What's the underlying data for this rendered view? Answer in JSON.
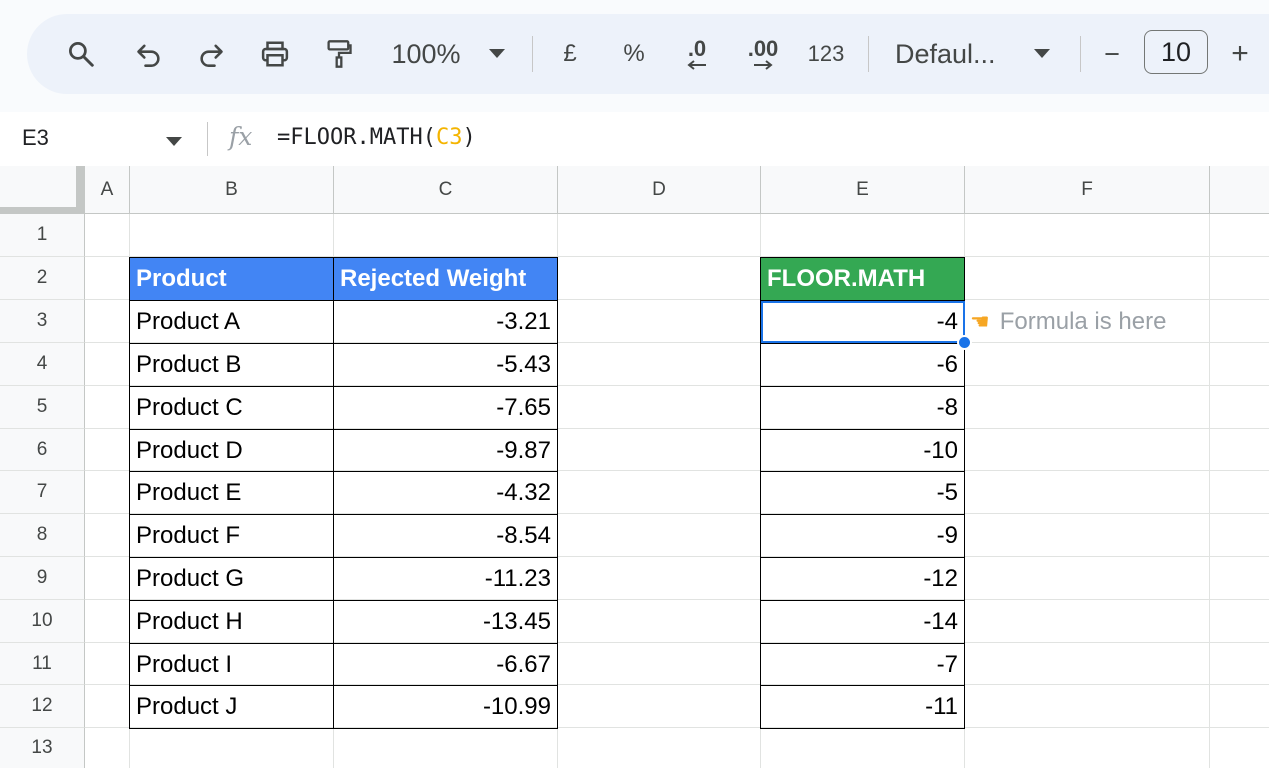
{
  "toolbar": {
    "zoom": "100%",
    "currency": "£",
    "percent": "%",
    "decrease_decimals": ".0",
    "increase_decimals": ".00",
    "number_format": "123",
    "font_name": "Defaul...",
    "minus": "−",
    "font_size": "10",
    "plus": "+",
    "icons": [
      "search-icon",
      "undo-icon",
      "redo-icon",
      "print-icon",
      "paint-format-icon",
      "chevron-down-icon"
    ]
  },
  "formula_bar": {
    "name_box": "E3",
    "fx": "fx",
    "formula_prefix": "=FLOOR.MATH(",
    "formula_ref": "C3",
    "formula_suffix": ")"
  },
  "columns": [
    "A",
    "B",
    "C",
    "D",
    "E",
    "F"
  ],
  "rows": [
    "1",
    "2",
    "3",
    "4",
    "5",
    "6",
    "7",
    "8",
    "9",
    "10",
    "11",
    "12",
    "13"
  ],
  "table": {
    "header_product": "Product",
    "header_weight": "Rejected Weight",
    "header_floor": "FLOOR.MATH",
    "products": [
      "Product A",
      "Product B",
      "Product C",
      "Product D",
      "Product E",
      "Product F",
      "Product G",
      "Product H",
      "Product I",
      "Product J"
    ],
    "weights": [
      "-3.21",
      "-5.43",
      "-7.65",
      "-9.87",
      "-4.32",
      "-8.54",
      "-11.23",
      "-13.45",
      "-6.67",
      "-10.99"
    ],
    "floor": [
      "-4",
      "-6",
      "-8",
      "-10",
      "-5",
      "-9",
      "-12",
      "-14",
      "-7",
      "-11"
    ]
  },
  "note": {
    "icon": "pointing-hand-icon",
    "text": "Formula is here"
  },
  "colors": {
    "header_blue": "#4285f4",
    "header_green": "#34a853",
    "selection": "#1a73e8",
    "formula_ref": "#f4b400"
  }
}
